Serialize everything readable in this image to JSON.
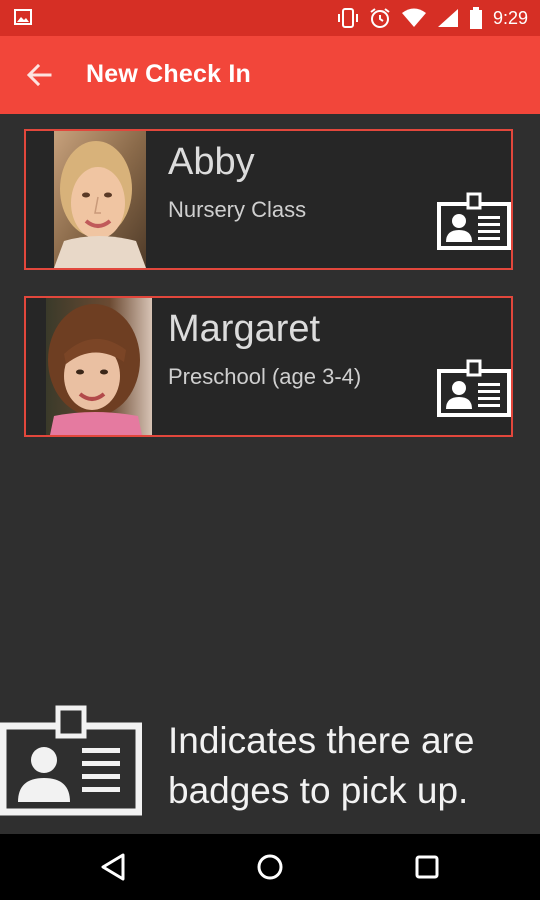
{
  "status_bar": {
    "time": "9:29",
    "icons": [
      "gallery-icon",
      "vibrate-icon",
      "alarm-icon",
      "wifi-icon",
      "signal-icon",
      "battery-icon"
    ]
  },
  "app_bar": {
    "title": "New Check In",
    "back_icon": "arrow-back-icon"
  },
  "people": [
    {
      "name": "Abby",
      "class": "Nursery Class",
      "badge_icon": "badge-icon"
    },
    {
      "name": "Margaret",
      "class": "Preschool (age 3-4)",
      "badge_icon": "badge-icon"
    }
  ],
  "legend": {
    "text": "Indicates there are badges to pick up.",
    "icon": "badge-icon"
  },
  "nav_bar": {
    "buttons": [
      "back-triangle-icon",
      "home-circle-icon",
      "recents-square-icon"
    ]
  },
  "colors": {
    "status_bar": "#d62f25",
    "app_bar": "#f2463a",
    "card_border": "#e2473c",
    "background": "#2f2f2f"
  }
}
